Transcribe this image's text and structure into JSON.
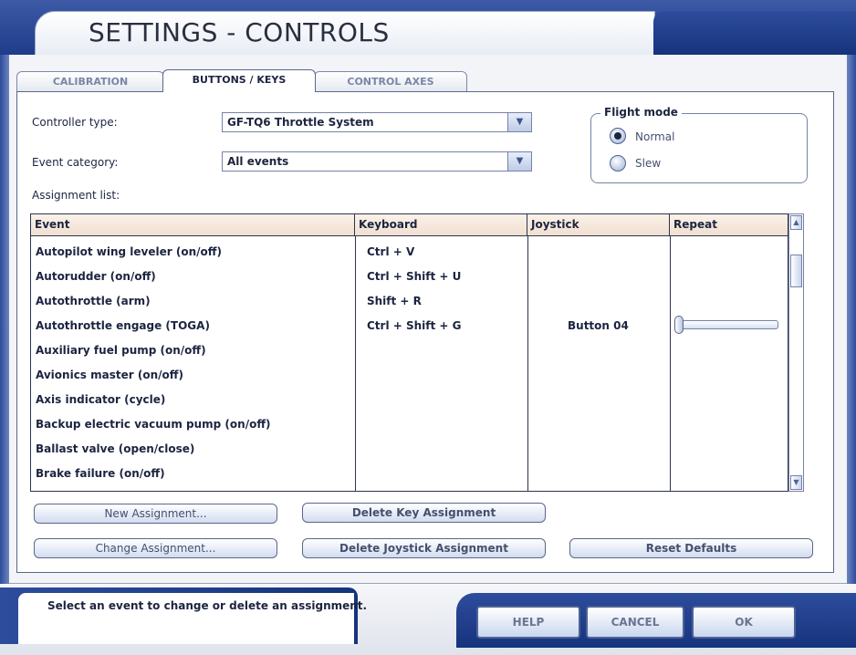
{
  "window": {
    "title": "SETTINGS - CONTROLS"
  },
  "tabs": [
    {
      "label": "CALIBRATION",
      "active": false
    },
    {
      "label": "BUTTONS / KEYS",
      "active": true
    },
    {
      "label": "CONTROL AXES",
      "active": false
    }
  ],
  "controller": {
    "label": "Controller type:",
    "value": "GF-TQ6 Throttle System"
  },
  "event_category": {
    "label": "Event category:",
    "value": "All events"
  },
  "flight_mode": {
    "title": "Flight mode",
    "options": [
      {
        "label": "Normal",
        "selected": true
      },
      {
        "label": "Slew",
        "selected": false
      }
    ]
  },
  "assignment_list": {
    "label": "Assignment list:",
    "columns": [
      "Event",
      "Keyboard",
      "Joystick",
      "Repeat"
    ],
    "rows": [
      {
        "event": "Autopilot wing leveler (on/off)",
        "keyboard": "Ctrl + V",
        "joystick": ""
      },
      {
        "event": "Autorudder (on/off)",
        "keyboard": "Ctrl + Shift + U",
        "joystick": ""
      },
      {
        "event": "Autothrottle (arm)",
        "keyboard": "Shift + R",
        "joystick": ""
      },
      {
        "event": "Autothrottle engage (TOGA)",
        "keyboard": "Ctrl + Shift + G",
        "joystick": "Button 04"
      },
      {
        "event": "Auxiliary fuel pump (on/off)",
        "keyboard": "",
        "joystick": ""
      },
      {
        "event": "Avionics master (on/off)",
        "keyboard": "",
        "joystick": ""
      },
      {
        "event": "Axis indicator (cycle)",
        "keyboard": "",
        "joystick": ""
      },
      {
        "event": "Backup electric vacuum pump (on/off)",
        "keyboard": "",
        "joystick": ""
      },
      {
        "event": "Ballast valve (open/close)",
        "keyboard": "",
        "joystick": ""
      },
      {
        "event": "Brake failure (on/off)",
        "keyboard": "",
        "joystick": ""
      }
    ],
    "repeat_slider_row": 3,
    "repeat_slider_value": 0
  },
  "buttons": {
    "new_assignment": "New Assignment...",
    "delete_key": "Delete Key Assignment",
    "change_assignment": "Change Assignment...",
    "delete_joystick": "Delete Joystick Assignment",
    "reset_defaults": "Reset Defaults"
  },
  "status": {
    "text": "Select an event to change or delete an assignment."
  },
  "footer": {
    "help": "HELP",
    "cancel": "CANCEL",
    "ok": "OK"
  }
}
